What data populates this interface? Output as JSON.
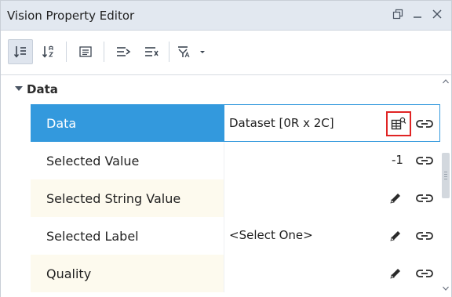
{
  "window": {
    "title": "Vision Property Editor"
  },
  "toolbar": {
    "buttons": [
      {
        "name": "sort-categorized",
        "icon": "sort-categorized-icon",
        "active": true
      },
      {
        "name": "sort-alphabetical",
        "icon": "sort-alphabetical-icon",
        "active": false
      },
      {
        "name": "show-descriptions",
        "icon": "description-panel-icon",
        "active": false
      },
      {
        "name": "expand-all",
        "icon": "expand-all-icon",
        "active": false
      },
      {
        "name": "collapse-all",
        "icon": "collapse-all-icon",
        "active": false
      },
      {
        "name": "filter",
        "icon": "filter-icon",
        "active": false
      }
    ]
  },
  "grid": {
    "category": {
      "label": "Data",
      "expanded": true
    },
    "properties": [
      {
        "name": "Data",
        "value": "Dataset [0R x 2C]",
        "selected": true,
        "editor": "dataset-viewer",
        "binding": true
      },
      {
        "name": "Selected Value",
        "value": "-1",
        "selected": false,
        "editor": "none",
        "binding": true
      },
      {
        "name": "Selected String Value",
        "value": "",
        "selected": false,
        "editor": "pencil",
        "binding": true
      },
      {
        "name": "Selected Label",
        "value": "<Select One>",
        "selected": false,
        "editor": "pencil",
        "binding": true
      },
      {
        "name": "Quality",
        "value": "",
        "selected": false,
        "editor": "pencil",
        "binding": true
      }
    ]
  },
  "colors": {
    "selection": "#3399dd",
    "highlight_box": "#e02424",
    "titlebar": "#e2e8f0",
    "alt_row": "#fdfaee"
  }
}
